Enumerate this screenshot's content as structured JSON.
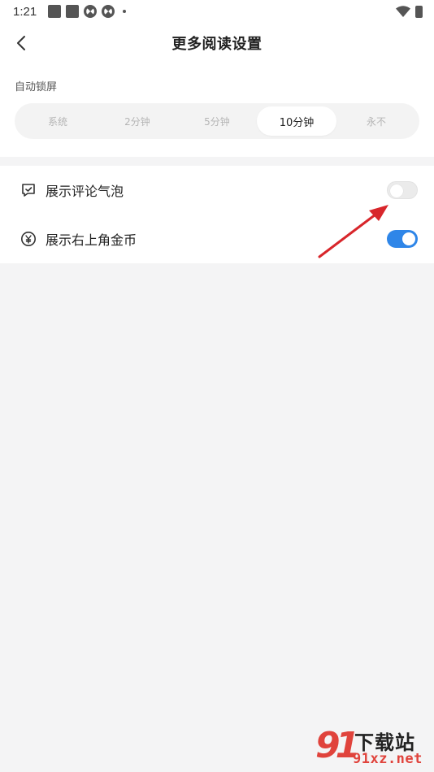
{
  "status_bar": {
    "time": "1:21"
  },
  "nav": {
    "title": "更多阅读设置"
  },
  "auto_lock": {
    "label": "自动锁屏",
    "options": [
      "系统",
      "2分钟",
      "5分钟",
      "10分钟",
      "永不"
    ],
    "selected": "10分钟"
  },
  "settings": [
    {
      "label": "展示评论气泡",
      "icon": "comment-bubble-icon",
      "enabled": false
    },
    {
      "label": "展示右上角金币",
      "icon": "yen-coin-icon",
      "enabled": true
    }
  ],
  "watermark": {
    "number": "91",
    "text": "下载站",
    "url": "91xz.net"
  },
  "colors": {
    "accent": "#2f86e8",
    "annotation": "#d8262b",
    "background": "#f4f4f5"
  }
}
